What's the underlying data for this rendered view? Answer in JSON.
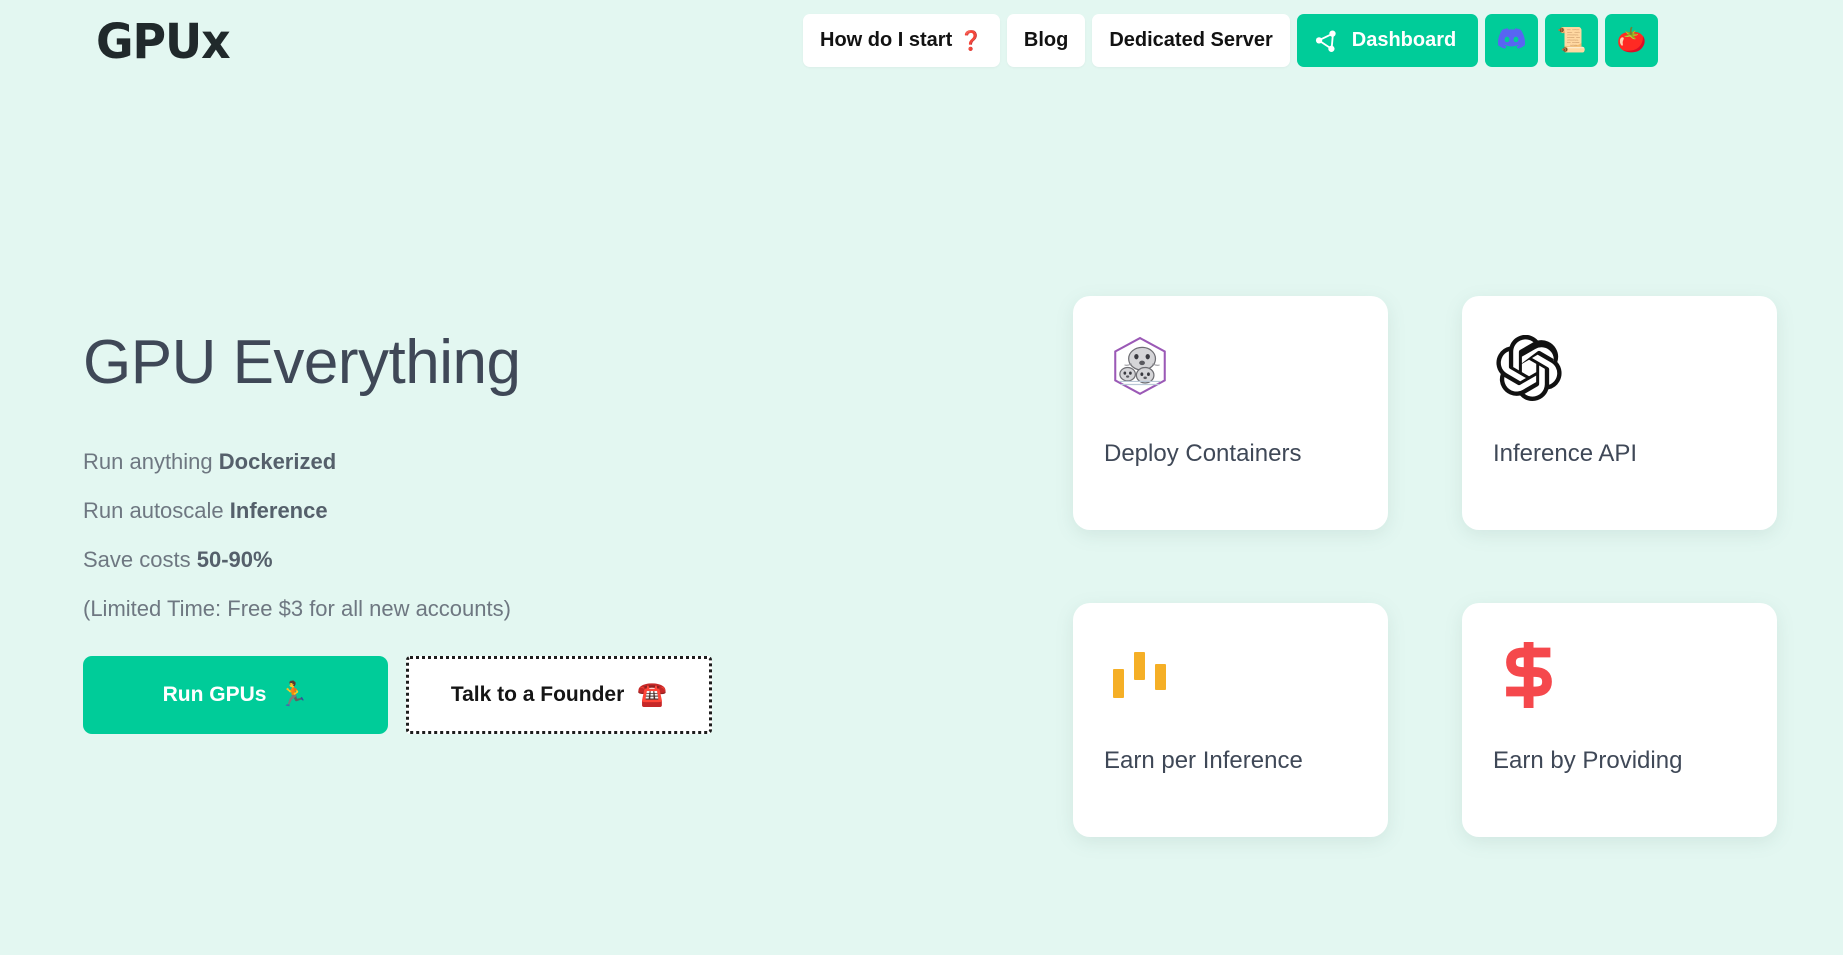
{
  "brand": {
    "logo": "GPUx"
  },
  "colors": {
    "background": "#e3f7f1",
    "accent_green": "#00cc99",
    "card_white": "#ffffff",
    "headline": "#3f4857",
    "body_text": "#6e7781",
    "bar_amber": "#f5af26",
    "dollar_red": "#f5484c",
    "discord_purple": "#5865f2"
  },
  "nav": {
    "items": [
      {
        "label": "How do I start",
        "emoji": "❓",
        "icon": "question-mark-icon"
      },
      {
        "label": "Blog",
        "emoji": "",
        "icon": ""
      },
      {
        "label": "Dedicated Server",
        "emoji": "",
        "icon": ""
      }
    ],
    "dashboard": {
      "label": "Dashboard",
      "icon": "share-network-icon"
    },
    "icon_buttons": [
      {
        "name": "discord-icon",
        "glyph": ""
      },
      {
        "name": "scroll-icon",
        "glyph": "📜"
      },
      {
        "name": "tomato-icon",
        "glyph": "🍅"
      }
    ]
  },
  "hero": {
    "headline": "GPU Everything",
    "bullets": [
      {
        "prefix": "Run anything ",
        "strong": "Dockerized"
      },
      {
        "prefix": "Run autoscale ",
        "strong": "Inference"
      },
      {
        "prefix": "Save costs ",
        "strong": "50-90%"
      }
    ],
    "note": "(Limited Time: Free $3 for all new accounts)",
    "primary_cta": {
      "label": "Run GPUs",
      "emoji": "🏃",
      "icon": "runner-icon"
    },
    "secondary_cta": {
      "label": "Talk to a Founder",
      "emoji": "☎️",
      "icon": "telephone-icon"
    }
  },
  "cards": [
    {
      "label": "Deploy Containers",
      "icon": "docker-whale-hexagon-icon"
    },
    {
      "label": "Inference API",
      "icon": "openai-logo-icon"
    },
    {
      "label": "Earn per Inference",
      "icon": "candlestick-bars-icon"
    },
    {
      "label": "Earn by Providing",
      "icon": "dollar-sign-icon"
    }
  ]
}
